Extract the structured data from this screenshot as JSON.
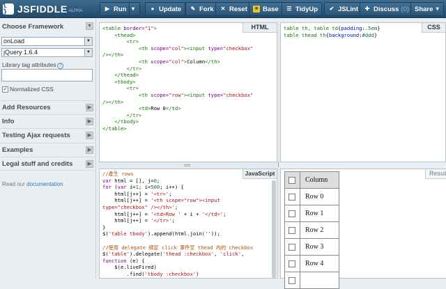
{
  "app": {
    "logo_mark": "{ }",
    "logo_name": "JSFIDDLE",
    "logo_sub": "ALPHA"
  },
  "toolbar": {
    "run": "Run",
    "update": "Update",
    "fork": "Fork",
    "reset": "Reset",
    "base": "Base",
    "tidyup": "TidyUp",
    "jslint": "JSLint",
    "discuss": "Discuss",
    "discuss_count": "(0)",
    "share": "Share"
  },
  "sidebar": {
    "framework_heading": "Choose Framework",
    "onload_value": "onLoad",
    "library_value": "jQuery 1.6.4",
    "library_tag_label": "Library tag attributes",
    "help_icon": "?",
    "normalized_label": "Normalized CSS",
    "normalized_checked": true,
    "sections": [
      {
        "label": "Add Resources"
      },
      {
        "label": "Info"
      },
      {
        "label": "Testing Ajax requests"
      },
      {
        "label": "Examples"
      },
      {
        "label": "Legal stuff and credits"
      }
    ],
    "read_prefix": "Read our",
    "read_link": "documentation"
  },
  "panels": {
    "html_label": "HTML",
    "css_label": "CSS",
    "js_label": "JavaScript",
    "result_label": "Resul"
  },
  "result": {
    "header": "Column",
    "rows": [
      "Row 0",
      "Row 1",
      "Row 2",
      "Row 3",
      "Row 4"
    ]
  },
  "colors": {
    "toolbar": "#2c577a",
    "tag": "#117700",
    "string": "#aa1111",
    "keyword": "#770088",
    "comment": "#aa5500"
  }
}
